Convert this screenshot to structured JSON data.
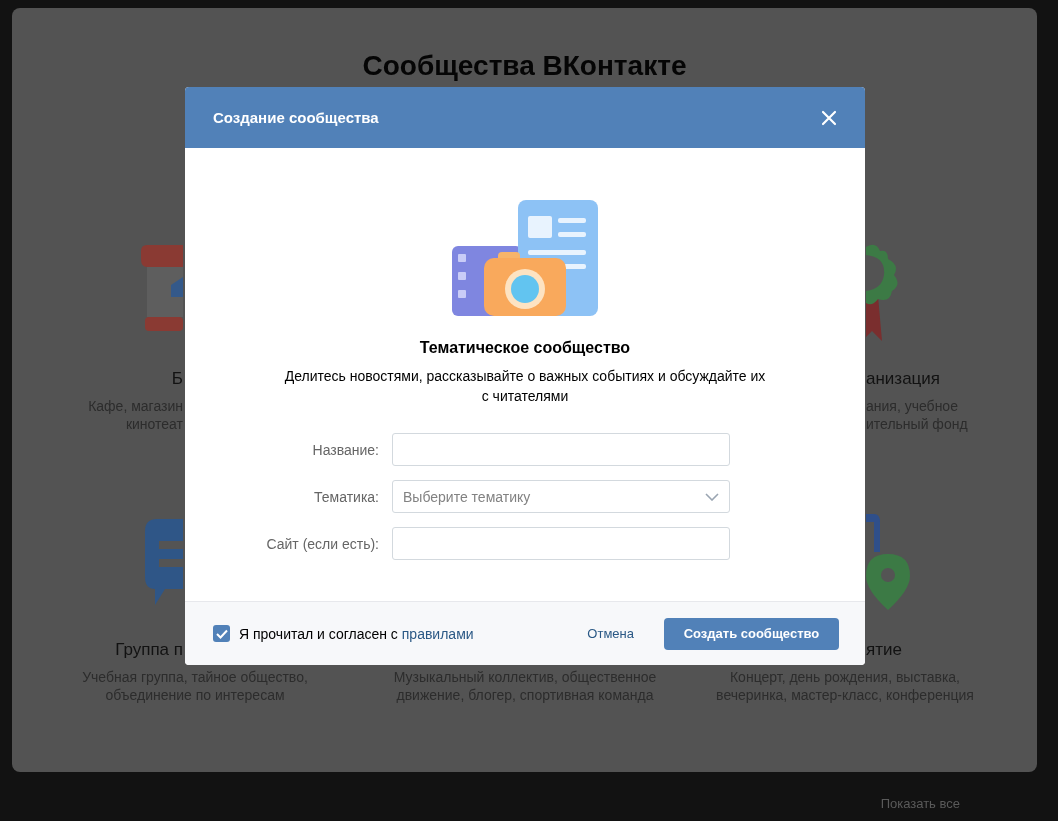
{
  "background": {
    "heading": "Сообщества ВКонтакте",
    "left_cards": [
      {
        "title": "Б",
        "description": [
          "Кафе, магазин",
          "кинотеат"
        ]
      },
      {
        "title": "Группа п",
        "description": [
          "Учебная группа, тайное общество,",
          "объединение по интересам"
        ]
      }
    ],
    "middle_cards": [
      {
        "description": [
          "Музыкальный коллектив, общественное",
          "движение, блогер, спортивная команда"
        ]
      }
    ],
    "right_cards": [
      {
        "title": "анизация",
        "description": [
          "ания, учебное",
          "ительный фонд"
        ]
      },
      {
        "title": "ятие",
        "description": [
          "Концерт, день рождения, выставка,",
          "вечеринка, мастер-класс, конференция"
        ]
      }
    ],
    "show_all": "Показать все"
  },
  "modal": {
    "title": "Создание сообщества",
    "heading": "Тематическое сообщество",
    "description": "Делитесь новостями, рассказывайте о важных событиях и обсуждайте их с читателями",
    "fields": [
      {
        "kind": "text",
        "label": "Название:"
      },
      {
        "kind": "select",
        "label": "Тематика:",
        "placeholder": "Выберите тематику"
      },
      {
        "kind": "text",
        "label": "Сайт (если есть):"
      }
    ],
    "agreement": {
      "checked": true,
      "text": "Я прочитал и согласен с ",
      "link": "правилами"
    },
    "cancel": "Отмена",
    "submit": "Создать сообщество"
  }
}
